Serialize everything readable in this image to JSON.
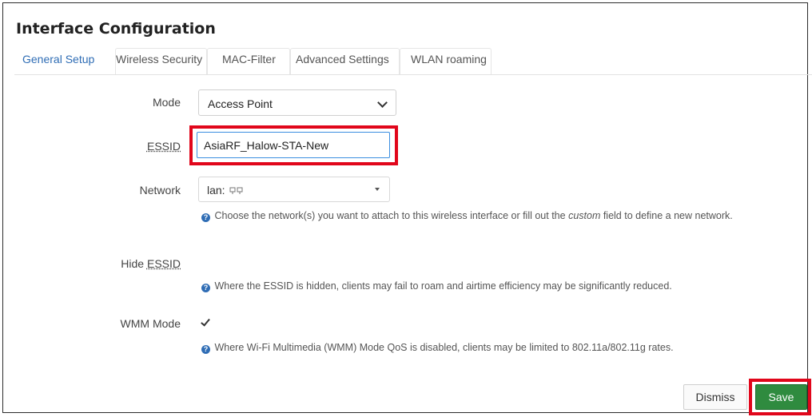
{
  "title": "Interface Configuration",
  "tabs": [
    {
      "label": "General Setup",
      "active": true
    },
    {
      "label": "Wireless Security",
      "active": false
    },
    {
      "label": "MAC-Filter",
      "active": false
    },
    {
      "label": "Advanced Settings",
      "active": false
    },
    {
      "label": "WLAN roaming",
      "active": false
    }
  ],
  "form": {
    "mode": {
      "label": "Mode",
      "value": "Access Point"
    },
    "essid": {
      "label": "ESSID",
      "value": "AsiaRF_Halow-STA-New"
    },
    "network": {
      "label": "Network",
      "value": "lan:",
      "help_pre": "Choose the network(s) you want to attach to this wireless interface or fill out the ",
      "help_em": "custom",
      "help_post": " field to define a new network."
    },
    "hide_essid": {
      "label_prefix": "Hide ",
      "label_underlined": "ESSID",
      "checked": false,
      "help": "Where the ESSID is hidden, clients may fail to roam and airtime efficiency may be significantly reduced."
    },
    "wmm_mode": {
      "label": "WMM Mode",
      "checked": true,
      "help": "Where Wi-Fi Multimedia (WMM) Mode QoS is disabled, clients may be limited to 802.11a/802.11g rates."
    }
  },
  "buttons": {
    "dismiss": "Dismiss",
    "save": "Save"
  },
  "colors": {
    "accent": "#2f6db5",
    "highlight": "#e1061b",
    "save": "#2f8b3f"
  },
  "icons": {
    "info": "info-circle-icon",
    "interface": "network-interface-icon"
  }
}
